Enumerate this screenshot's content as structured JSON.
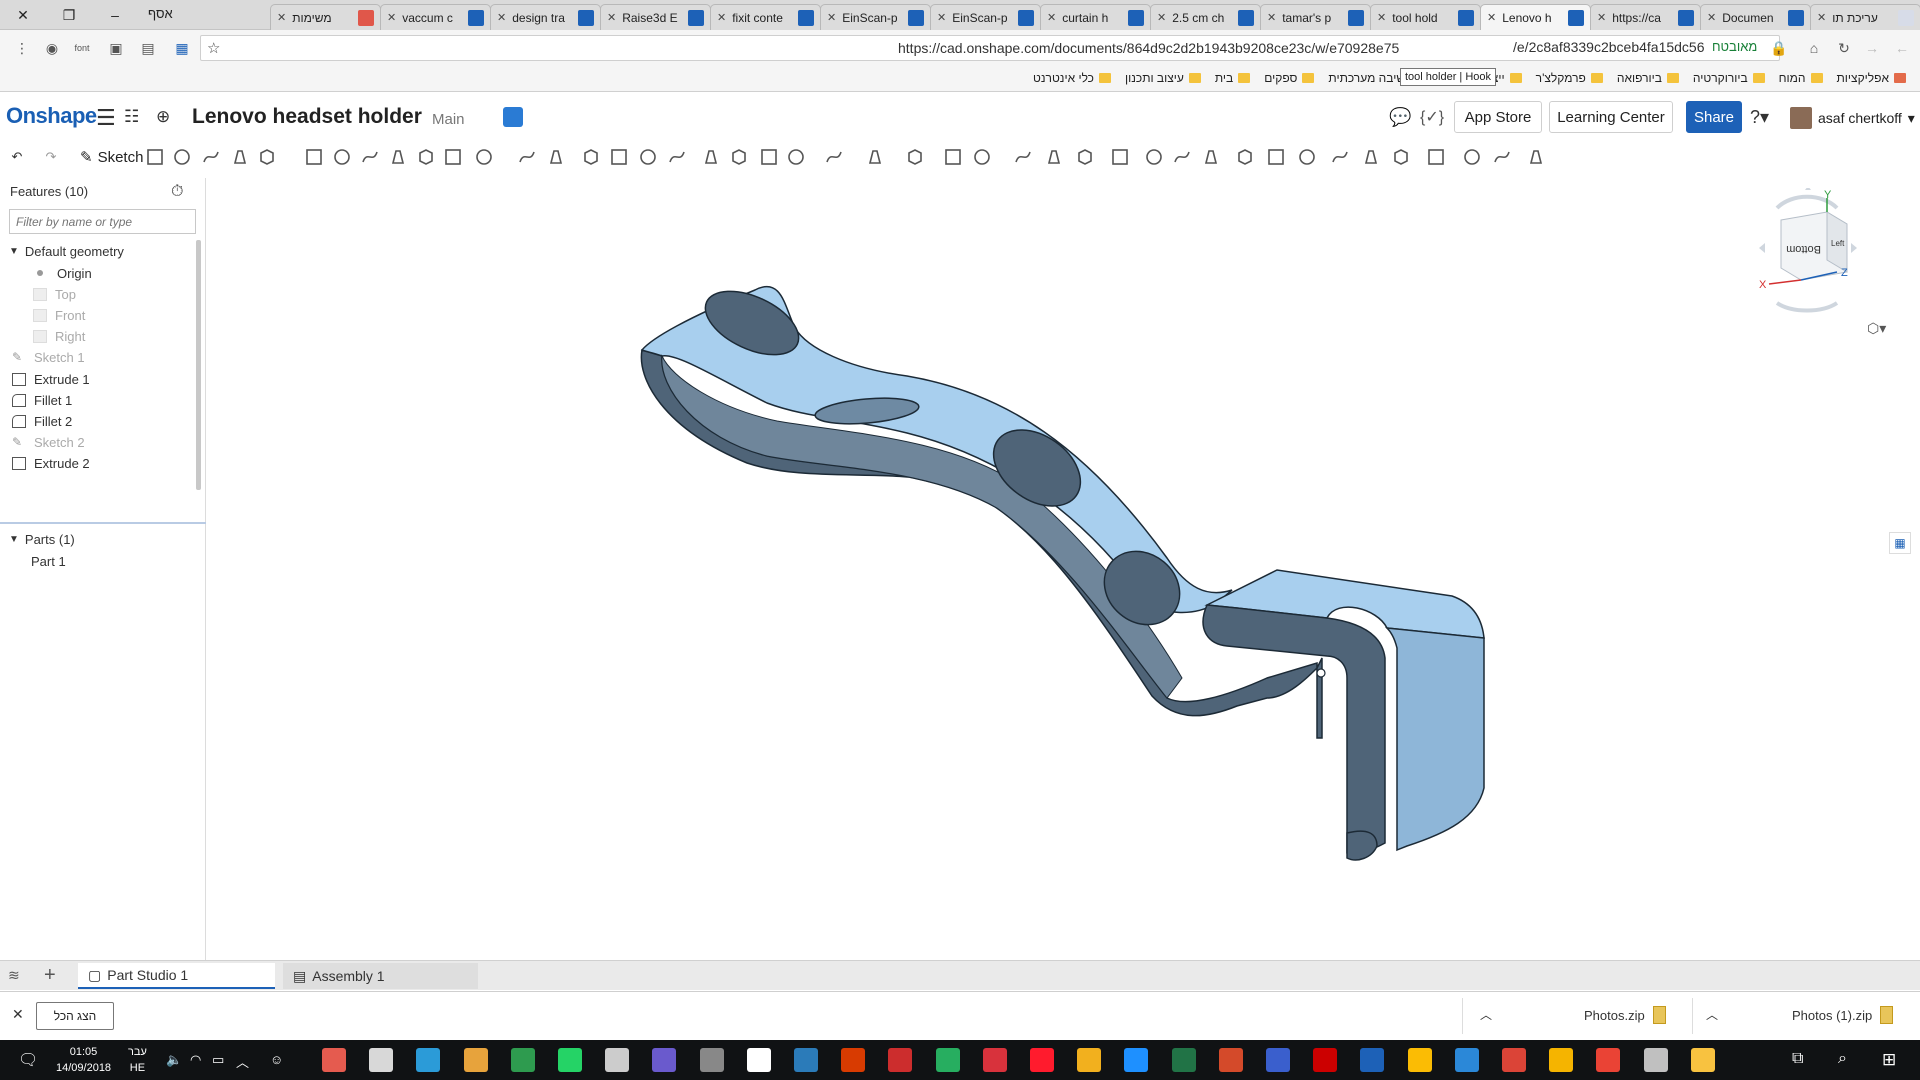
{
  "browser": {
    "tabs": [
      {
        "title": "עריכת תו",
        "fav": "#d7dce8"
      },
      {
        "title": "Documen",
        "fav": "#1d61b7"
      },
      {
        "title": "https://ca",
        "fav": "#1d61b7"
      },
      {
        "title": "Lenovo h",
        "fav": "#1d61b7",
        "active": true
      },
      {
        "title": "tool hold",
        "fav": "#1d61b7"
      },
      {
        "title": "tamar's p",
        "fav": "#1d61b7"
      },
      {
        "title": "2.5 cm ch",
        "fav": "#1d61b7"
      },
      {
        "title": "curtain h",
        "fav": "#1d61b7"
      },
      {
        "title": "EinScan-p",
        "fav": "#1d61b7"
      },
      {
        "title": "EinScan-p",
        "fav": "#1d61b7"
      },
      {
        "title": "fixit conte",
        "fav": "#1d61b7"
      },
      {
        "title": "Raise3d E",
        "fav": "#1d61b7"
      },
      {
        "title": "design tra",
        "fav": "#1d61b7"
      },
      {
        "title": "vaccum c",
        "fav": "#1d61b7"
      },
      {
        "title": "משימות",
        "fav": "#e0574a"
      }
    ],
    "user_tab": "אסף",
    "url": "https://cad.onshape.com/documents/864d9c2d2b1943b9208ce23c/w/e70928e75",
    "url_tooltip": "tool holder | Hook",
    "url_tail": "/e/2c8af8339c2bceb4fa15dc56",
    "secure_label": "מאובטח",
    "bookmarks": [
      "אפליקציות",
      "המוח",
      "ביורוקרטיה",
      "ביורפואה",
      "פרמקלצ'ר",
      "ייצור דיגיטלי",
      "חשיבה מערכתית",
      "ספקים",
      "בית",
      "עיצוב ותכנון",
      "כלי אינטרנט"
    ]
  },
  "onshape": {
    "logo": "Onshape",
    "document_title": "Lenovo headset holder",
    "workspace": "Main",
    "app_store": "App Store",
    "learning_center": "Learning Center",
    "share": "Share",
    "user_name": "asaf chertkoff",
    "sketch_label": "Sketch"
  },
  "features": {
    "header": "Features (10)",
    "filter_placeholder": "Filter by name or type",
    "default_geometry": "Default geometry",
    "items": [
      {
        "label": "Origin",
        "type": "origin"
      },
      {
        "label": "Top",
        "type": "plane"
      },
      {
        "label": "Front",
        "type": "plane"
      },
      {
        "label": "Right",
        "type": "plane"
      },
      {
        "label": "Sketch 1",
        "type": "sketch"
      },
      {
        "label": "Extrude 1",
        "type": "extrude"
      },
      {
        "label": "Fillet 1",
        "type": "fillet"
      },
      {
        "label": "Fillet 2",
        "type": "fillet"
      },
      {
        "label": "Sketch 2",
        "type": "sketch"
      },
      {
        "label": "Extrude 2",
        "type": "extrude"
      }
    ],
    "parts_header": "Parts (1)",
    "parts": [
      "Part 1"
    ]
  },
  "viewcube": {
    "face_label": "Bottom",
    "side_label": "Left",
    "axis_x": "X",
    "axis_y": "Y",
    "axis_z": "Z"
  },
  "bottom_tabs": {
    "part_studio": "Part Studio 1",
    "assembly": "Assembly 1"
  },
  "downloads": {
    "show_all": "הצג הכל",
    "items": [
      "Photos.zip",
      "Photos (1).zip"
    ]
  },
  "taskbar": {
    "time": "01:05",
    "date": "14/09/2018",
    "day": "עבר",
    "lang": "HE"
  },
  "colors": {
    "model_top": "#a8cfee",
    "model_side": "#4f6478",
    "accent": "#1d61b7"
  }
}
